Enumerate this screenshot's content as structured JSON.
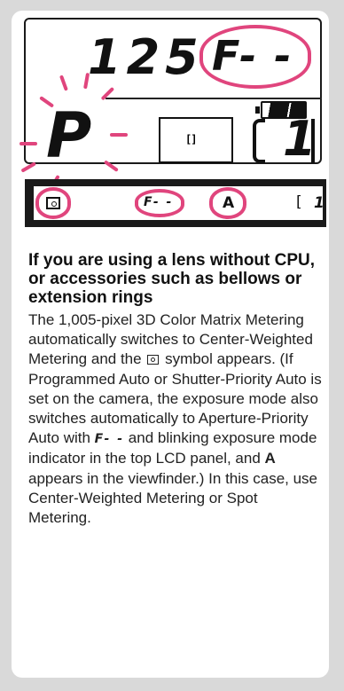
{
  "lcd": {
    "shutter": "125",
    "aperture": "F- -",
    "mode": "P",
    "meter_symbol": "[]",
    "frame_count": "1"
  },
  "viewfinder": {
    "aperture": "F- -",
    "mode": "A",
    "frame_count": "1"
  },
  "heading": "If you are using a lens without CPU, or accessories such as bellows or extension rings",
  "body": {
    "part1": "The 1,005-pixel 3D Color Matrix Metering automatically switches to Center-Weighted Metering and the",
    "part2": "symbol appears. (If Programmed Auto or Shutter-Priority Auto is set on the camera, the exposure mode also switches automatically to Aperture-Priority Auto with",
    "inline_aperture": "F- -",
    "part3": "and blinking exposure mode indicator in the top LCD panel, and",
    "bold_a": "A",
    "part4": "appears in the viewfinder.) In this case, use Center-Weighted Metering or Spot Metering."
  },
  "colors": {
    "highlight": "#e0457d",
    "ink": "#111111",
    "background": "#d9d9d9"
  }
}
